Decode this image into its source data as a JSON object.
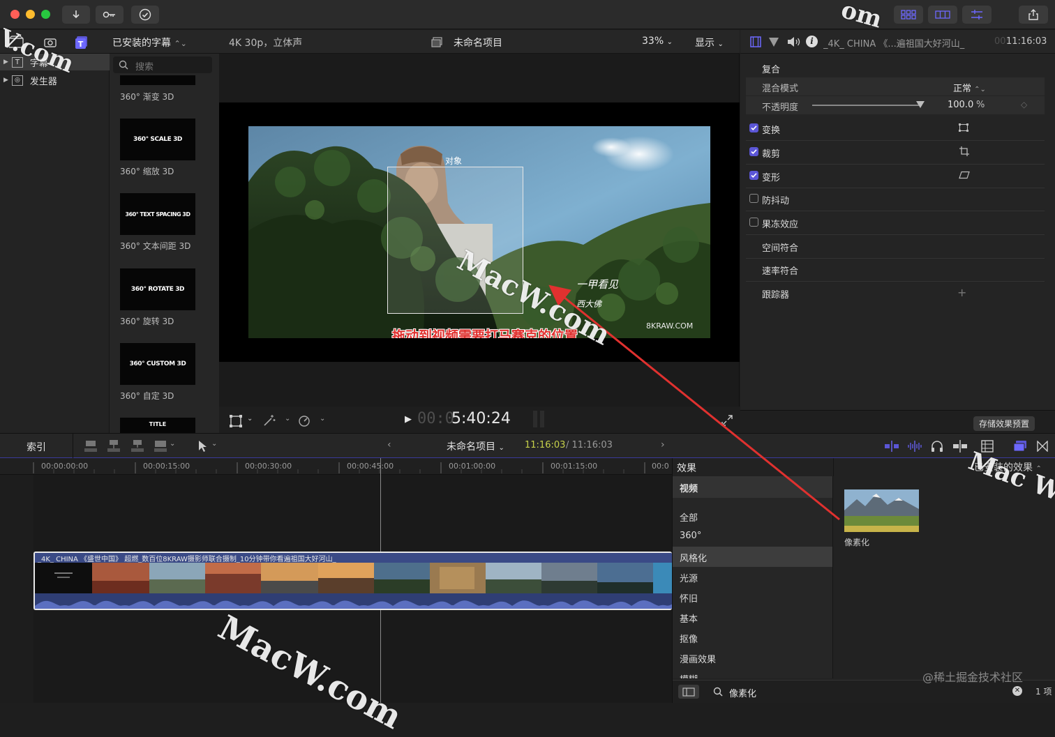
{
  "titlebar": {
    "traffic_lights": [
      "#ff5f57",
      "#febc2e",
      "#28c840"
    ],
    "buttons": [
      "download-icon",
      "key-icon",
      "checkmark-icon"
    ],
    "view_buttons": [
      "grid-icon",
      "film-strip-icon",
      "sliders-icon"
    ],
    "share": "share-icon"
  },
  "browser": {
    "library_dropdown": "已安装的字幕",
    "search_placeholder": "搜索",
    "sidebar": [
      {
        "label": "字幕",
        "icon": "titles-icon"
      },
      {
        "label": "发生器",
        "icon": "generators-icon"
      }
    ],
    "top_item_label": "360° 渐变 3D",
    "items": [
      {
        "thumb": "360° SCALE 3D",
        "label": "360° 缩放 3D"
      },
      {
        "thumb": "360° TEXT SPACING 3D",
        "label": "360° 文本间距 3D"
      },
      {
        "thumb": "360° ROTATE 3D",
        "label": "360° 旋转 3D"
      },
      {
        "thumb": "360° CUSTOM 3D",
        "label": "360° 自定 3D"
      },
      {
        "thumb": "TITLE",
        "label": ""
      }
    ]
  },
  "viewer": {
    "format": "4K 30p，立体声",
    "project_title": "未命名项目",
    "zoom": "33%",
    "display_menu": "显示",
    "object_label": "对象",
    "video_caption": "拖动到视频需要打马赛克的位置",
    "video_watermark": "8KRAW.COM",
    "video_poem_1": "一甲看见",
    "video_poem_2": "西大佛",
    "timecode_dim": "00:0",
    "timecode": "5:40:24"
  },
  "inspector": {
    "clip_name": "_4K_ CHINA 《...遍祖国大好河山_",
    "duration_dim": "00:",
    "duration": "11:16:03",
    "section": "复合",
    "blend_mode_label": "混合模式",
    "blend_mode_value": "正常",
    "opacity_label": "不透明度",
    "opacity_value": "100.0",
    "opacity_unit": "%",
    "opacity_fraction": 1.0,
    "rows": [
      {
        "label": "变换",
        "checked": true,
        "icon": "transform-icon"
      },
      {
        "label": "裁剪",
        "checked": true,
        "icon": "crop-icon"
      },
      {
        "label": "变形",
        "checked": true,
        "icon": "distort-icon"
      },
      {
        "label": "防抖动",
        "checked": false
      },
      {
        "label": "果冻效应",
        "checked": false
      }
    ],
    "plain_rows": [
      "空间符合",
      "速率符合",
      "跟踪器"
    ],
    "save_preset": "存储效果预置"
  },
  "timeline": {
    "index_label": "索引",
    "project_name": "未命名项目",
    "position": "11:16:03",
    "total": "/ 11:16:03",
    "ruler": [
      "00:00:00:00",
      "00:00:15:00",
      "00:00:30:00",
      "00:00:45:00",
      "00:01:00:00",
      "00:01:15:00",
      "00:0"
    ],
    "clip_title": "_4K_ CHINA 《盛世中国》 超燃_数百位8KRAW摄影师联合摄制_10分钟带你看遍祖国大好河山_"
  },
  "effects": {
    "title": "效果",
    "installed_label": "已安装的效果",
    "header": "视频",
    "categories": [
      "全部",
      "360°",
      "风格化",
      "光源",
      "怀旧",
      "基本",
      "抠像",
      "漫画效果",
      "模糊"
    ],
    "selected_category": "风格化",
    "result_label": "像素化",
    "search_value": "像素化",
    "count": "1 项"
  },
  "overlay": {
    "watermarks": [
      "MacW.com",
      "MacW.com",
      "V.com",
      "Mac W",
      "om"
    ],
    "community": "@稀土掘金技术社区",
    "arrow_color": "#e0312f"
  }
}
